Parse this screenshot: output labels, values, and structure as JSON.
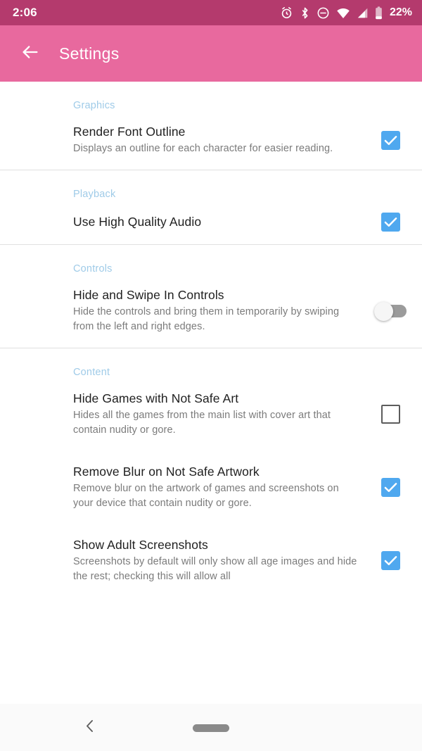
{
  "status_bar": {
    "time": "2:06",
    "battery_percent": "22%",
    "icons": [
      "alarm-icon",
      "bluetooth-icon",
      "do-not-disturb-icon",
      "wifi-icon",
      "cell-signal-icon",
      "battery-icon"
    ]
  },
  "app_bar": {
    "title": "Settings",
    "back_icon": "arrow-back-icon",
    "background_color": "#e8699e"
  },
  "theme": {
    "accent_checked": "#4fa8ef",
    "section_header_color": "#9fcbe8",
    "status_bar_color": "#b43a6d"
  },
  "sections": [
    {
      "header": "Graphics",
      "items": [
        {
          "title": "Render Font Outline",
          "summary": "Displays an outline for each character for easier reading.",
          "widget": "checkbox",
          "state": "checked"
        }
      ]
    },
    {
      "header": "Playback",
      "items": [
        {
          "title": "Use High Quality Audio",
          "summary": "",
          "widget": "checkbox",
          "state": "checked"
        }
      ]
    },
    {
      "header": "Controls",
      "items": [
        {
          "title": "Hide and Swipe In Controls",
          "summary": "Hide the controls and bring them in temporarily by swiping from the left and right edges.",
          "widget": "switch",
          "state": "off"
        }
      ]
    },
    {
      "header": "Content",
      "items": [
        {
          "title": "Hide Games with Not Safe Art",
          "summary": "Hides all the games from the main list with cover art that contain nudity or gore.",
          "widget": "checkbox",
          "state": "unchecked"
        },
        {
          "title": "Remove Blur on Not Safe Artwork",
          "summary": "Remove blur on the artwork of games and screenshots on your device that contain nudity or gore.",
          "widget": "checkbox",
          "state": "checked"
        },
        {
          "title": "Show Adult Screenshots",
          "summary": "Screenshots by default will only show all age images and hide the rest; checking this will allow all",
          "widget": "checkbox",
          "state": "checked"
        }
      ]
    }
  ],
  "nav_bar": {
    "back_icon": "chevron-back-icon",
    "home_pill": "gesture-home-pill"
  }
}
